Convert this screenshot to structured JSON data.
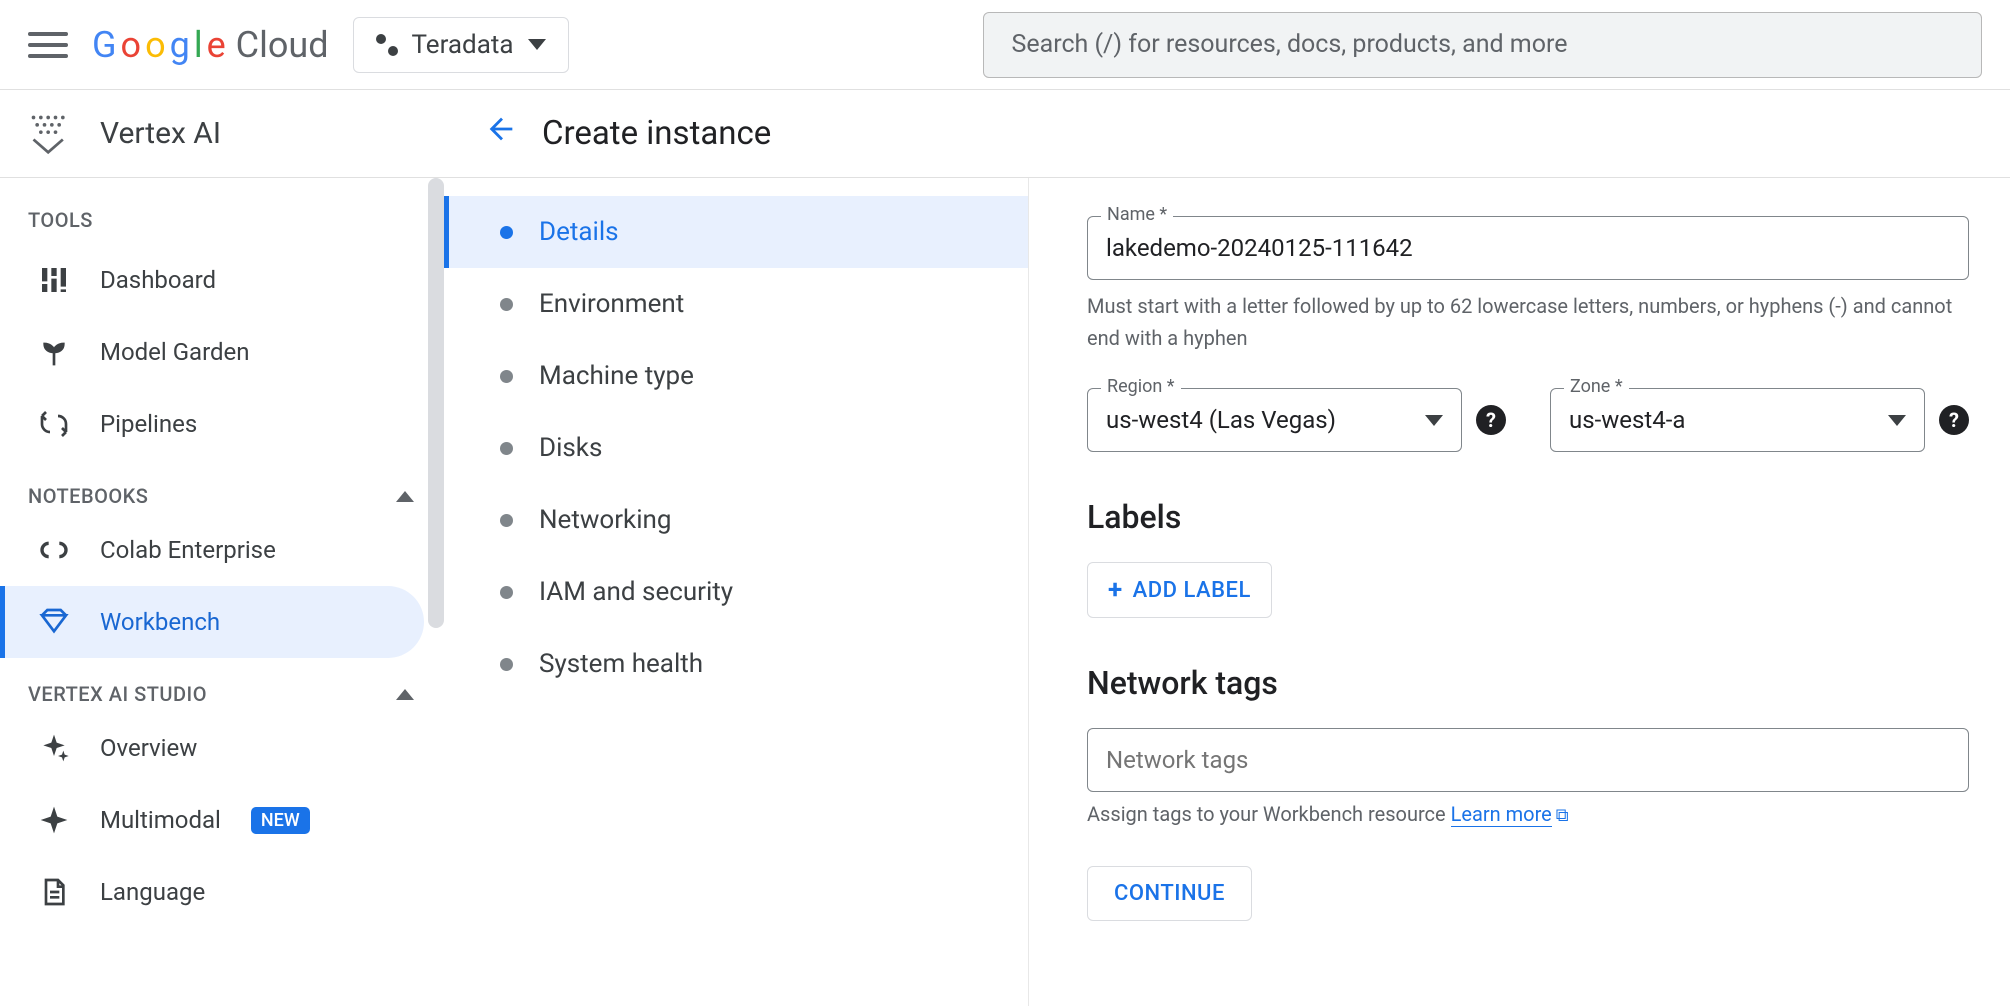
{
  "header": {
    "logo_google": "Google",
    "logo_cloud": "Cloud",
    "project_name": "Teradata",
    "search_placeholder": "Search (/) for resources, docs, products, and more"
  },
  "product": {
    "title": "Vertex AI",
    "page_title": "Create instance"
  },
  "sidebar": {
    "tools_header": "TOOLS",
    "tools": [
      {
        "label": "Dashboard"
      },
      {
        "label": "Model Garden"
      },
      {
        "label": "Pipelines"
      }
    ],
    "notebooks_header": "NOTEBOOKS",
    "notebooks": [
      {
        "label": "Colab Enterprise"
      },
      {
        "label": "Workbench"
      }
    ],
    "vstudio_header": "VERTEX AI STUDIO",
    "vstudio": [
      {
        "label": "Overview"
      },
      {
        "label": "Multimodal",
        "badge": "NEW"
      },
      {
        "label": "Language"
      }
    ]
  },
  "steps": [
    "Details",
    "Environment",
    "Machine type",
    "Disks",
    "Networking",
    "IAM and security",
    "System health"
  ],
  "form": {
    "name_label": "Name *",
    "name_value": "lakedemo-20240125-111642",
    "name_helper": "Must start with a letter followed by up to 62 lowercase letters, numbers, or hyphens (-) and cannot end with a hyphen",
    "region_label": "Region *",
    "region_value": "us-west4 (Las Vegas)",
    "zone_label": "Zone *",
    "zone_value": "us-west4-a",
    "labels_header": "Labels",
    "add_label": "ADD LABEL",
    "tags_header": "Network tags",
    "tags_placeholder": "Network tags",
    "tags_helper": "Assign tags to your Workbench resource ",
    "tags_learn_more": "Learn more",
    "continue": "CONTINUE"
  }
}
